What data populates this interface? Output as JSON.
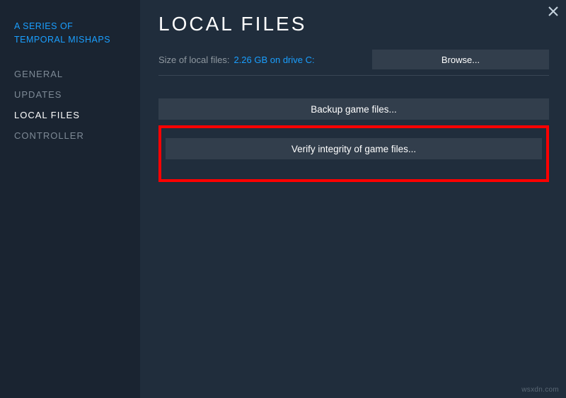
{
  "sidebar": {
    "game_title": "A SERIES OF TEMPORAL MISHAPS",
    "items": [
      {
        "label": "GENERAL"
      },
      {
        "label": "UPDATES"
      },
      {
        "label": "LOCAL FILES"
      },
      {
        "label": "CONTROLLER"
      }
    ],
    "active_index": 2
  },
  "main": {
    "title": "LOCAL FILES",
    "size_label": "Size of local files:",
    "size_value": "2.26 GB on drive C:",
    "browse_label": "Browse...",
    "backup_label": "Backup game files...",
    "verify_label": "Verify integrity of game files..."
  },
  "watermark": "wsxdn.com"
}
